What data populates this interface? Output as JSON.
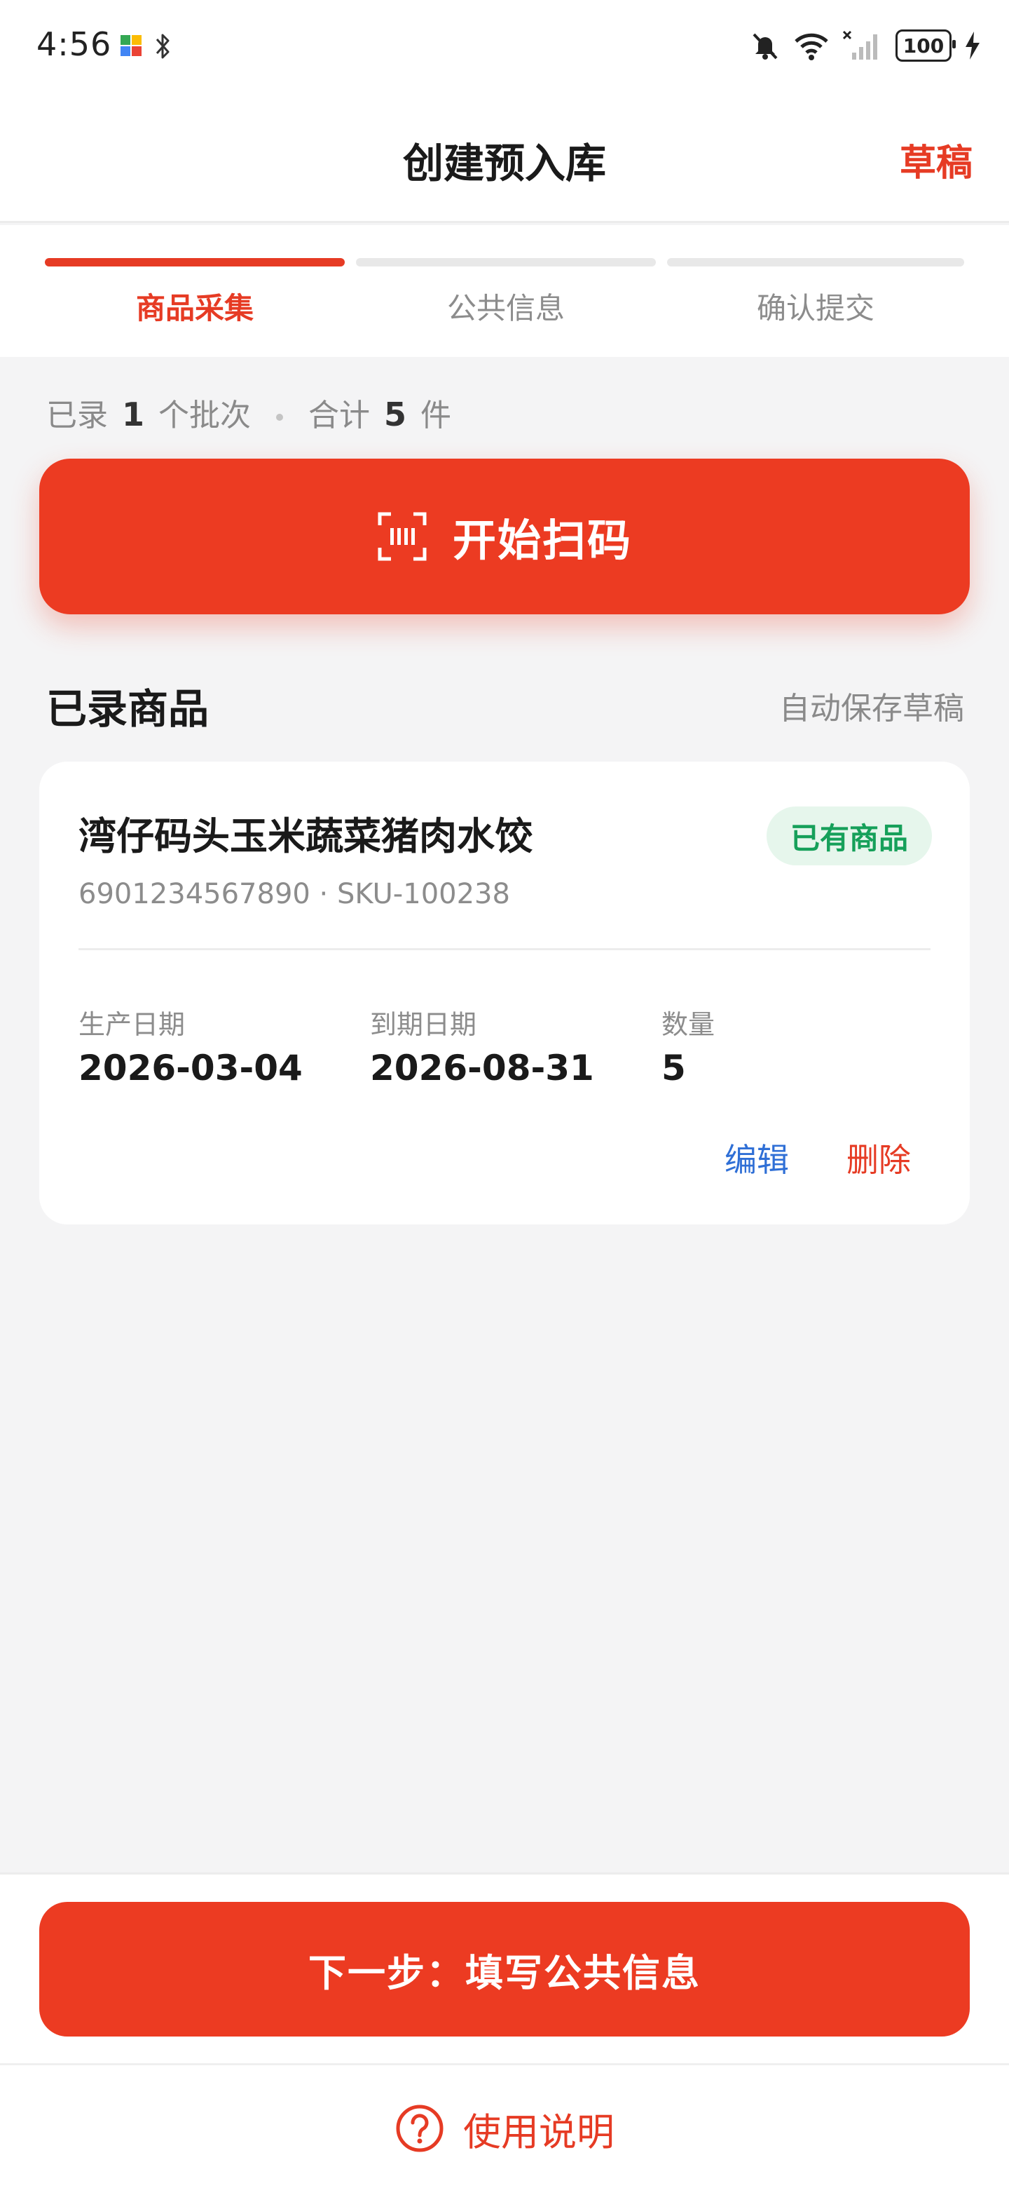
{
  "status_bar": {
    "time": "4:56",
    "battery": "100",
    "icons": [
      "app-icon",
      "bluetooth-icon",
      "mute-bell-icon",
      "wifi-icon",
      "signal-icon",
      "battery-icon",
      "charging-icon"
    ]
  },
  "header": {
    "title": "创建预入库",
    "draft": "草稿"
  },
  "steps": [
    {
      "label": "商品采集",
      "active": true
    },
    {
      "label": "公共信息",
      "active": false
    },
    {
      "label": "确认提交",
      "active": false
    }
  ],
  "summary": {
    "prefix": "已录",
    "batches": "1",
    "batch_unit": "个批次",
    "total_label": "合计",
    "total": "5",
    "total_unit": "件"
  },
  "scan_button": {
    "label": "开始扫码"
  },
  "section": {
    "title": "已录商品",
    "autosave": "自动保存草稿"
  },
  "items": [
    {
      "name": "湾仔码头玉米蔬菜猪肉水饺",
      "badge": "已有商品",
      "codes": "6901234567890 · SKU-100238",
      "production_date_label": "生产日期",
      "production_date": "2026-03-04",
      "expiry_date_label": "到期日期",
      "expiry_date": "2026-08-31",
      "quantity_label": "数量",
      "quantity": "5",
      "edit": "编辑",
      "delete": "删除"
    }
  ],
  "next_button": {
    "label": "下一步：填写公共信息"
  },
  "help": {
    "label": "使用说明"
  },
  "colors": {
    "accent": "#ec3b22",
    "success": "#16a05a",
    "link": "#2f6fd6",
    "background": "#f4f4f5"
  }
}
